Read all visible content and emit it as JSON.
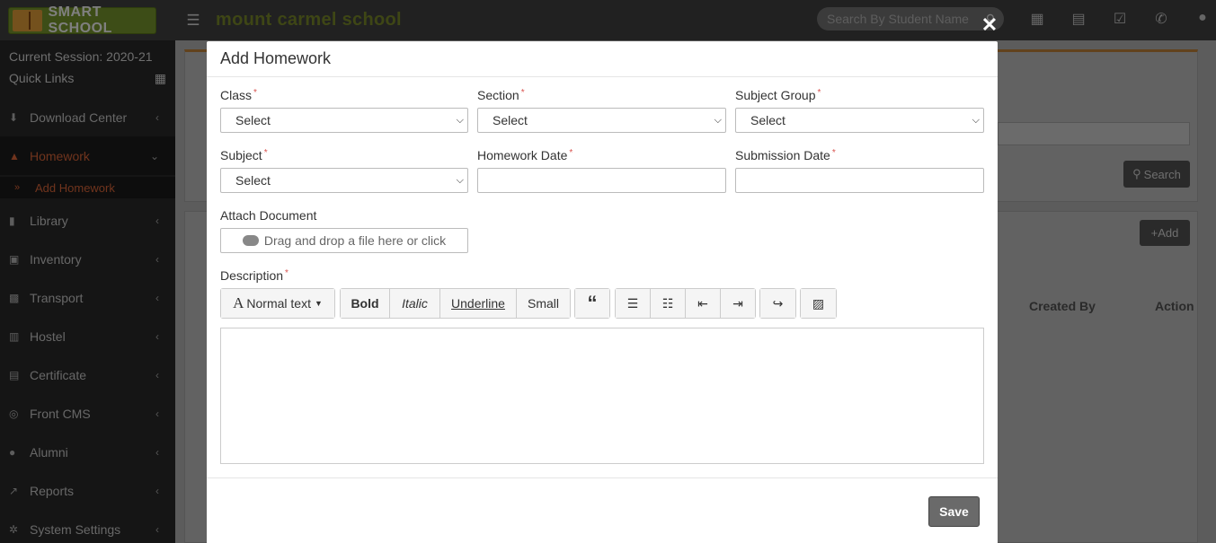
{
  "app": {
    "logo_text": "SMART SCHOOL",
    "school_name": "mount carmel school"
  },
  "topbar": {
    "search_placeholder": "Search By Student Name"
  },
  "sidebar": {
    "session": "Current Session: 2020-21",
    "quick_links": "Quick Links",
    "items": [
      {
        "label": "Download Center",
        "icon": "download-icon"
      },
      {
        "label": "Homework",
        "icon": "flask-icon"
      },
      {
        "label": "Library",
        "icon": "book-icon"
      },
      {
        "label": "Inventory",
        "icon": "inventory-icon"
      },
      {
        "label": "Transport",
        "icon": "bus-icon"
      },
      {
        "label": "Hostel",
        "icon": "building-icon"
      },
      {
        "label": "Certificate",
        "icon": "certificate-icon"
      },
      {
        "label": "Front CMS",
        "icon": "cms-icon"
      },
      {
        "label": "Alumni",
        "icon": "alumni-icon"
      },
      {
        "label": "Reports",
        "icon": "chart-icon"
      },
      {
        "label": "System Settings",
        "icon": "gears-icon"
      }
    ],
    "sub_item": "Add Homework"
  },
  "background": {
    "search_btn": "Search",
    "add_btn": "Add",
    "created_by": "Created By",
    "action": "Action"
  },
  "modal": {
    "title": "Add Homework",
    "fields": {
      "class_label": "Class",
      "section_label": "Section",
      "subject_group_label": "Subject Group",
      "subject_label": "Subject",
      "homework_date_label": "Homework Date",
      "submission_date_label": "Submission Date",
      "attach_label": "Attach Document",
      "description_label": "Description",
      "select_placeholder": "Select",
      "dropzone_text": "Drag and drop a file here or click",
      "required_mark": "*"
    },
    "toolbar": {
      "normal_text": "Normal text",
      "bold": "Bold",
      "italic": "Italic",
      "underline": "Underline",
      "small": "Small"
    },
    "save": "Save"
  },
  "colors": {
    "accent": "#e0683a",
    "brand_green": "#7c8c2a"
  }
}
